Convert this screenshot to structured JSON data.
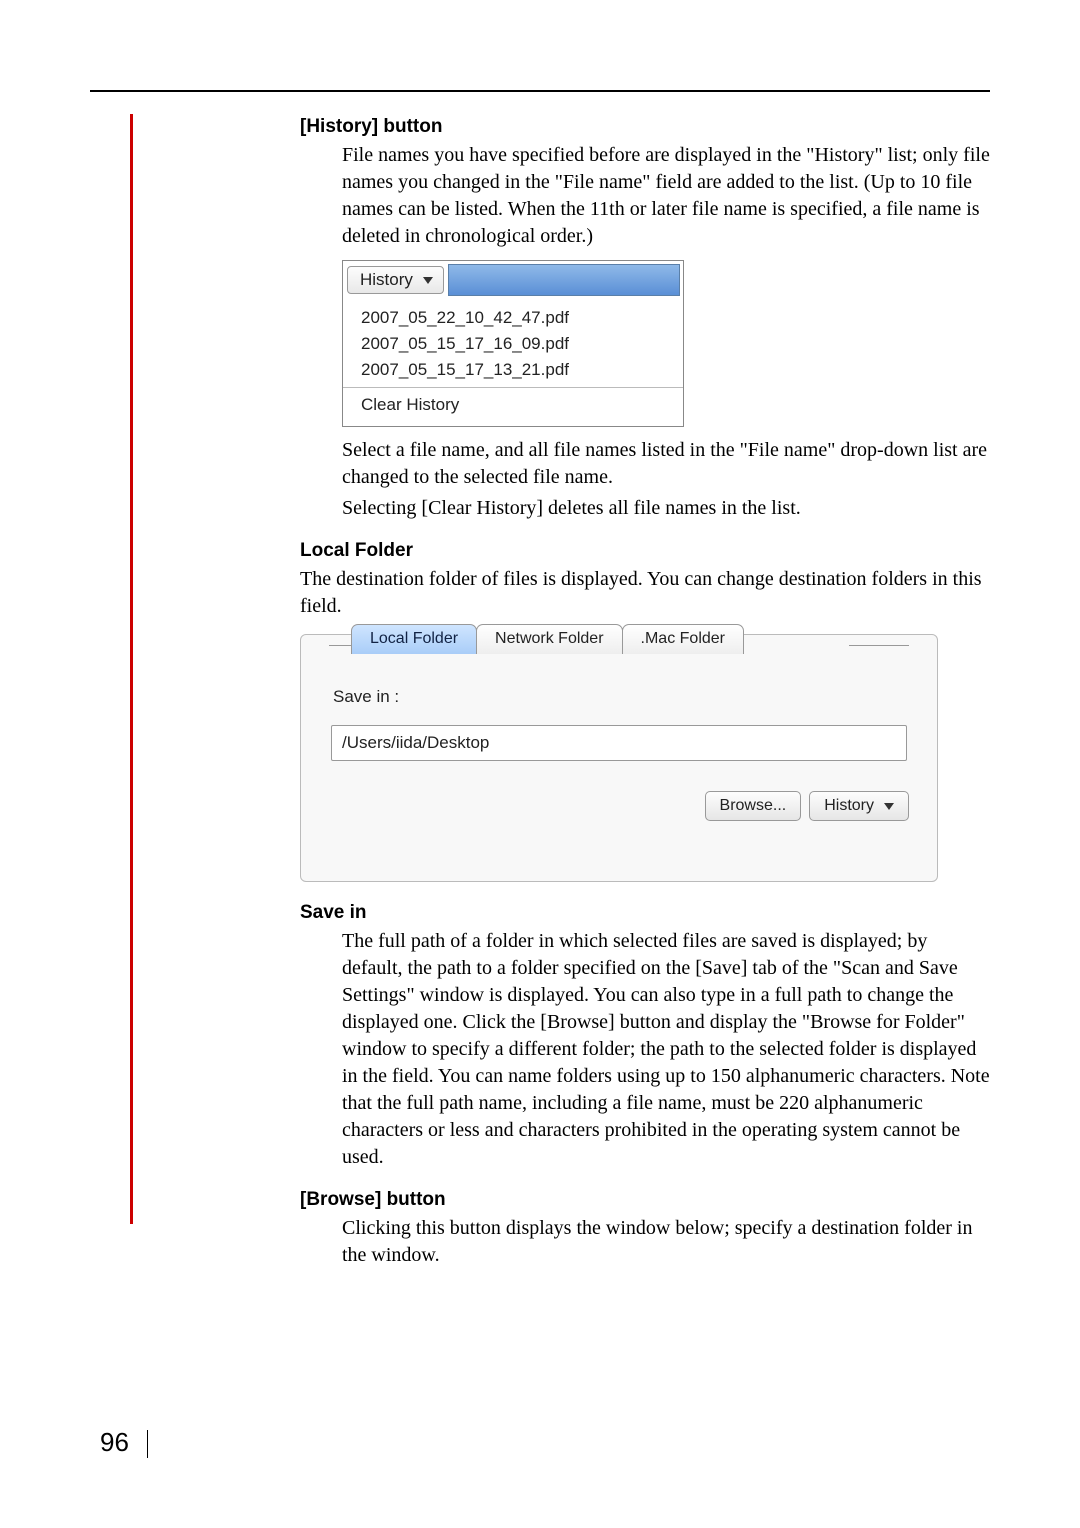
{
  "page_number": "96",
  "sections": {
    "history_button": {
      "heading": "[History] button",
      "para1": "File names you have specified before are displayed in the \"History\" list; only file names you changed in the \"File name\" field are added to the list. (Up to 10 file names can be listed. When the 11th or later file name is specified, a file name is deleted in chronological order.)",
      "para2": "Select a file name, and all file names listed in the \"File name\" drop-down list are changed to the selected file name.",
      "para3": "Selecting [Clear History] deletes all file names in the list."
    },
    "local_folder": {
      "heading": "Local Folder",
      "para": "The destination folder of files is displayed. You can change destination folders in this field."
    },
    "save_in": {
      "heading": "Save in",
      "para": "The full path of a folder in which selected files are saved is displayed; by default, the path to a folder specified on the [Save] tab of the \"Scan and Save Settings\" window is displayed. You can also type in a full path to change the displayed one. Click the [Browse] button and display the \"Browse for Folder\" window to specify a different folder; the path to the selected folder is displayed in the field. You can name folders using up to 150 alphanumeric characters. Note that the full path name, including a file name, must be 220 alphanumeric characters or less and characters prohibited in the operating system cannot be used."
    },
    "browse_button": {
      "heading": "[Browse] button",
      "para": "Clicking this button displays the window below; specify a destination folder in the window."
    }
  },
  "history_menu": {
    "button_label": "History",
    "items": [
      "2007_05_22_10_42_47.pdf",
      "2007_05_15_17_16_09.pdf",
      "2007_05_15_17_13_21.pdf"
    ],
    "clear_label": "Clear History"
  },
  "folder_panel": {
    "tabs": {
      "local": "Local Folder",
      "network": "Network Folder",
      "mac": ".Mac Folder"
    },
    "save_in_label": "Save in :",
    "path_value": "/Users/iida/Desktop",
    "browse_label": "Browse...",
    "history_label": "History"
  }
}
